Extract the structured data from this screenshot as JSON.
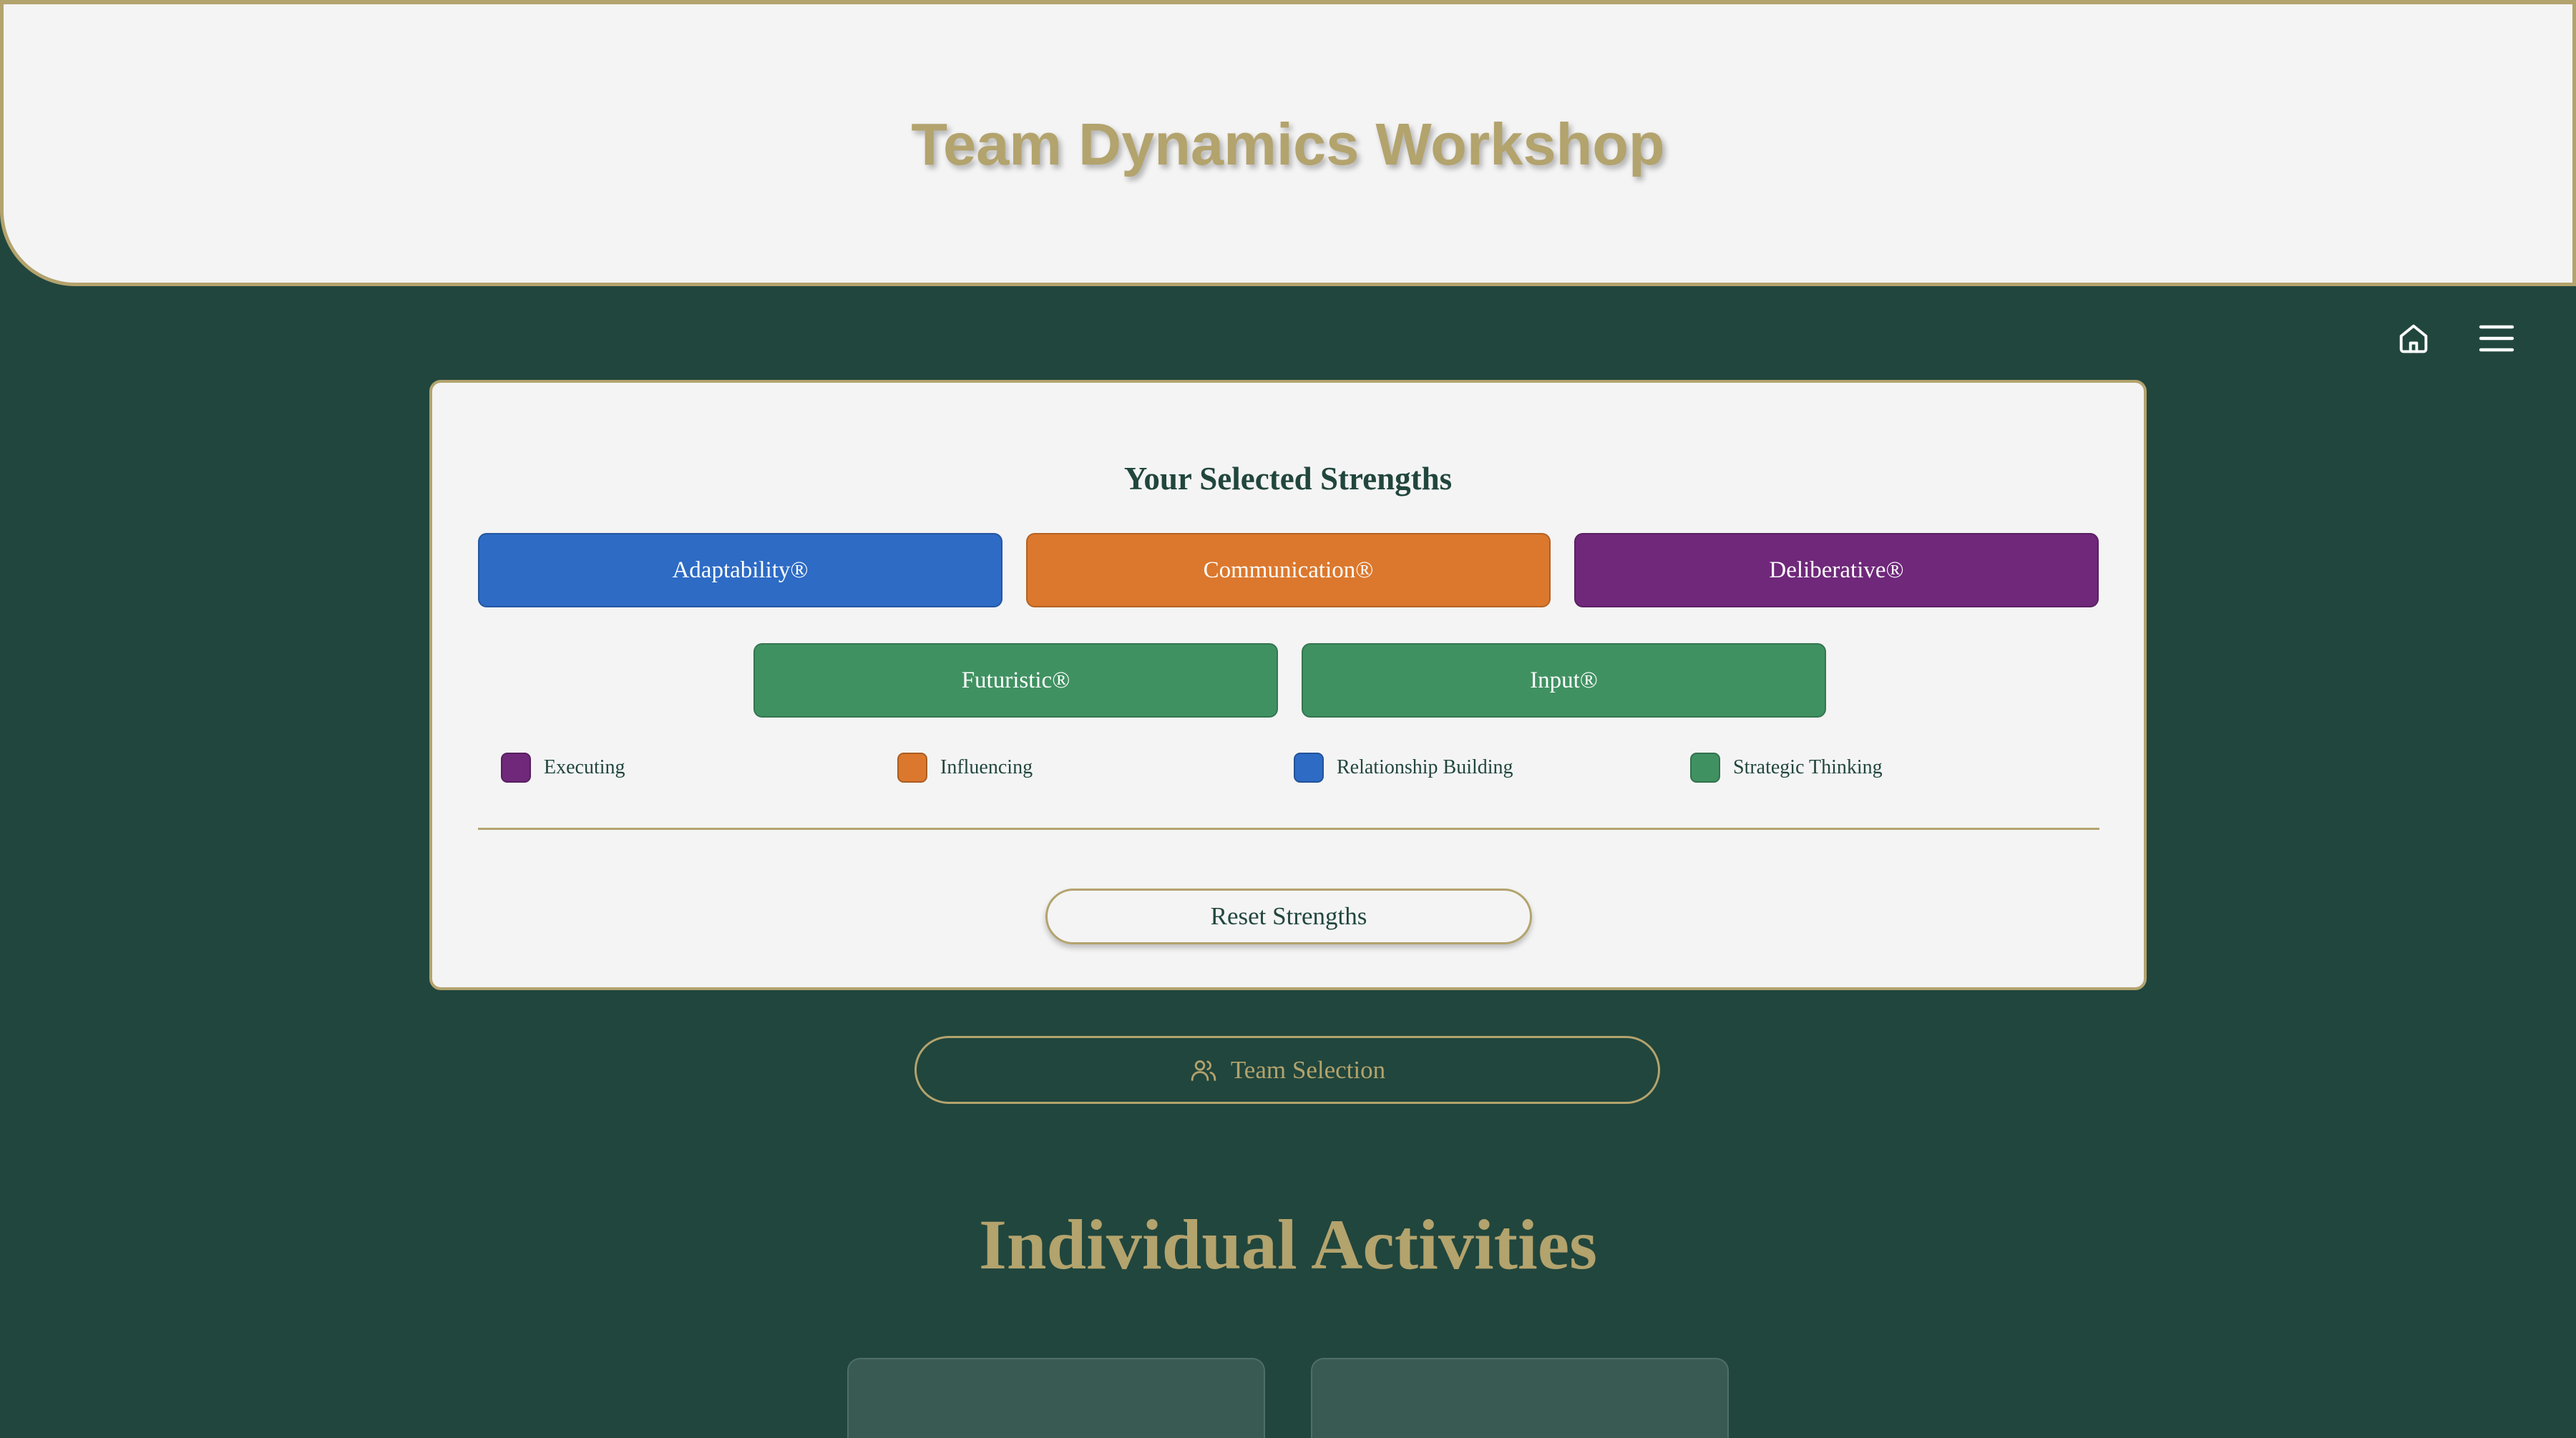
{
  "header": {
    "title": "Team Dynamics Workshop"
  },
  "nav": {
    "home_icon": "home-icon",
    "menu_icon": "hamburger-menu-icon"
  },
  "strengths_card": {
    "title": "Your Selected Strengths",
    "strengths": [
      {
        "label": "Adaptability®",
        "domain": "Relationship Building",
        "color": "#2d6bc5"
      },
      {
        "label": "Communication®",
        "domain": "Influencing",
        "color": "#db782d"
      },
      {
        "label": "Deliberative®",
        "domain": "Executing",
        "color": "#6f287a"
      },
      {
        "label": "Futuristic®",
        "domain": "Strategic Thinking",
        "color": "#409162"
      },
      {
        "label": "Input®",
        "domain": "Strategic Thinking",
        "color": "#409162"
      }
    ],
    "legend": [
      {
        "label": "Executing",
        "color": "#6f287a"
      },
      {
        "label": "Influencing",
        "color": "#db782d"
      },
      {
        "label": "Relationship Building",
        "color": "#2d6bc5"
      },
      {
        "label": "Strategic Thinking",
        "color": "#409162"
      }
    ],
    "reset_label": "Reset Strengths"
  },
  "team_selection": {
    "label": "Team Selection",
    "icon": "users-icon"
  },
  "individual_activities": {
    "title": "Individual Activities",
    "cards_visible": 2
  },
  "colors": {
    "background": "#21463d",
    "accent_gold": "#b3a36d",
    "panel": "#f4f4f4",
    "activity_card": "#385a52"
  }
}
